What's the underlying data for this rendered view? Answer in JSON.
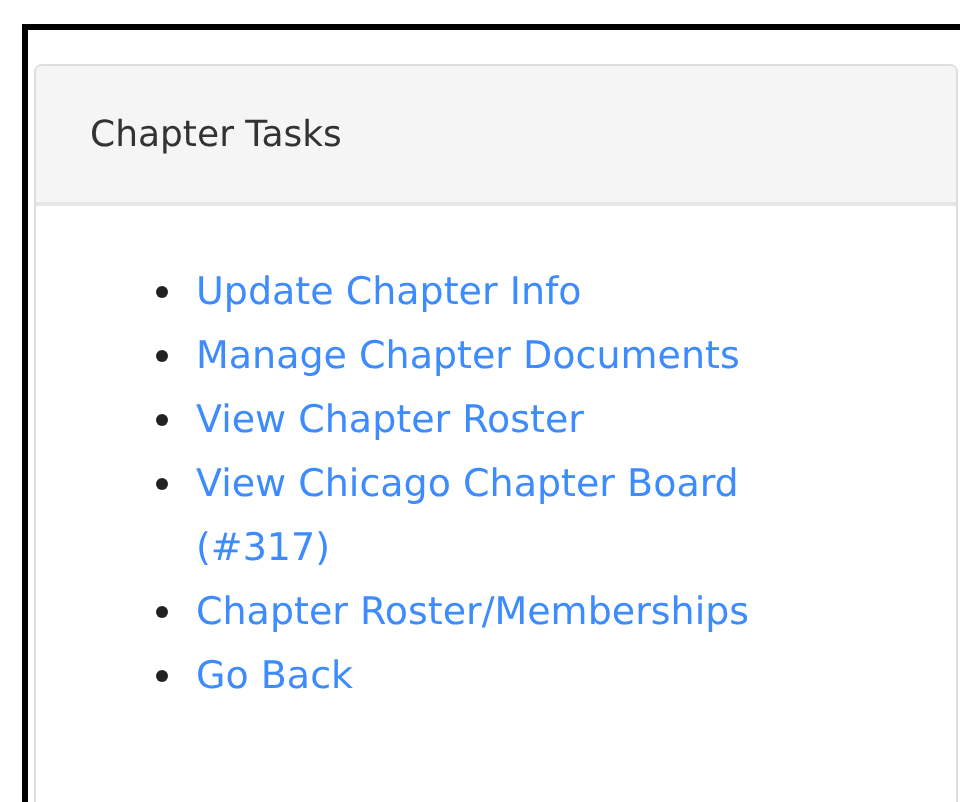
{
  "panel": {
    "title": "Chapter Tasks",
    "links": [
      {
        "label": "Update Chapter Info"
      },
      {
        "label": "Manage Chapter Documents"
      },
      {
        "label": "View Chapter Roster"
      },
      {
        "label": "View Chicago Chapter Board (#317)"
      },
      {
        "label": "Chapter Roster/Memberships"
      },
      {
        "label": "Go Back"
      }
    ]
  }
}
